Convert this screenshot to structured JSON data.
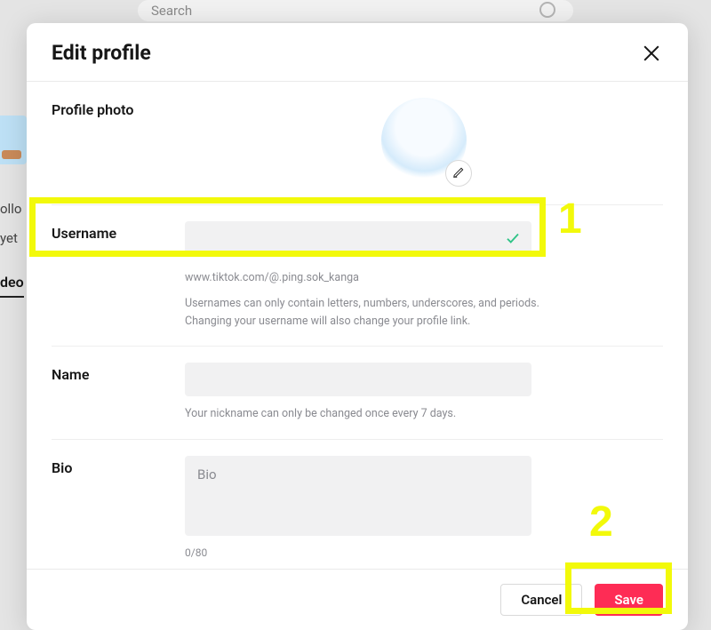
{
  "background": {
    "search_placeholder": "Search",
    "left_text_1": "ollo",
    "left_text_2": "yet",
    "left_text_3": "deo"
  },
  "modal": {
    "title": "Edit profile",
    "sections": {
      "photo": {
        "label": "Profile photo"
      },
      "username": {
        "label": "Username",
        "value": "",
        "url": "www.tiktok.com/@.ping.sok_kanga",
        "help": "Usernames can only contain letters, numbers, underscores, and periods. Changing your username will also change your profile link."
      },
      "name": {
        "label": "Name",
        "value": "",
        "help": "Your nickname can only be changed once every 7 days."
      },
      "bio": {
        "label": "Bio",
        "placeholder": "Bio",
        "value": "",
        "counter": "0/80"
      }
    },
    "footer": {
      "cancel": "Cancel",
      "save": "Save"
    }
  },
  "annotations": {
    "num1": "1",
    "num2": "2"
  }
}
